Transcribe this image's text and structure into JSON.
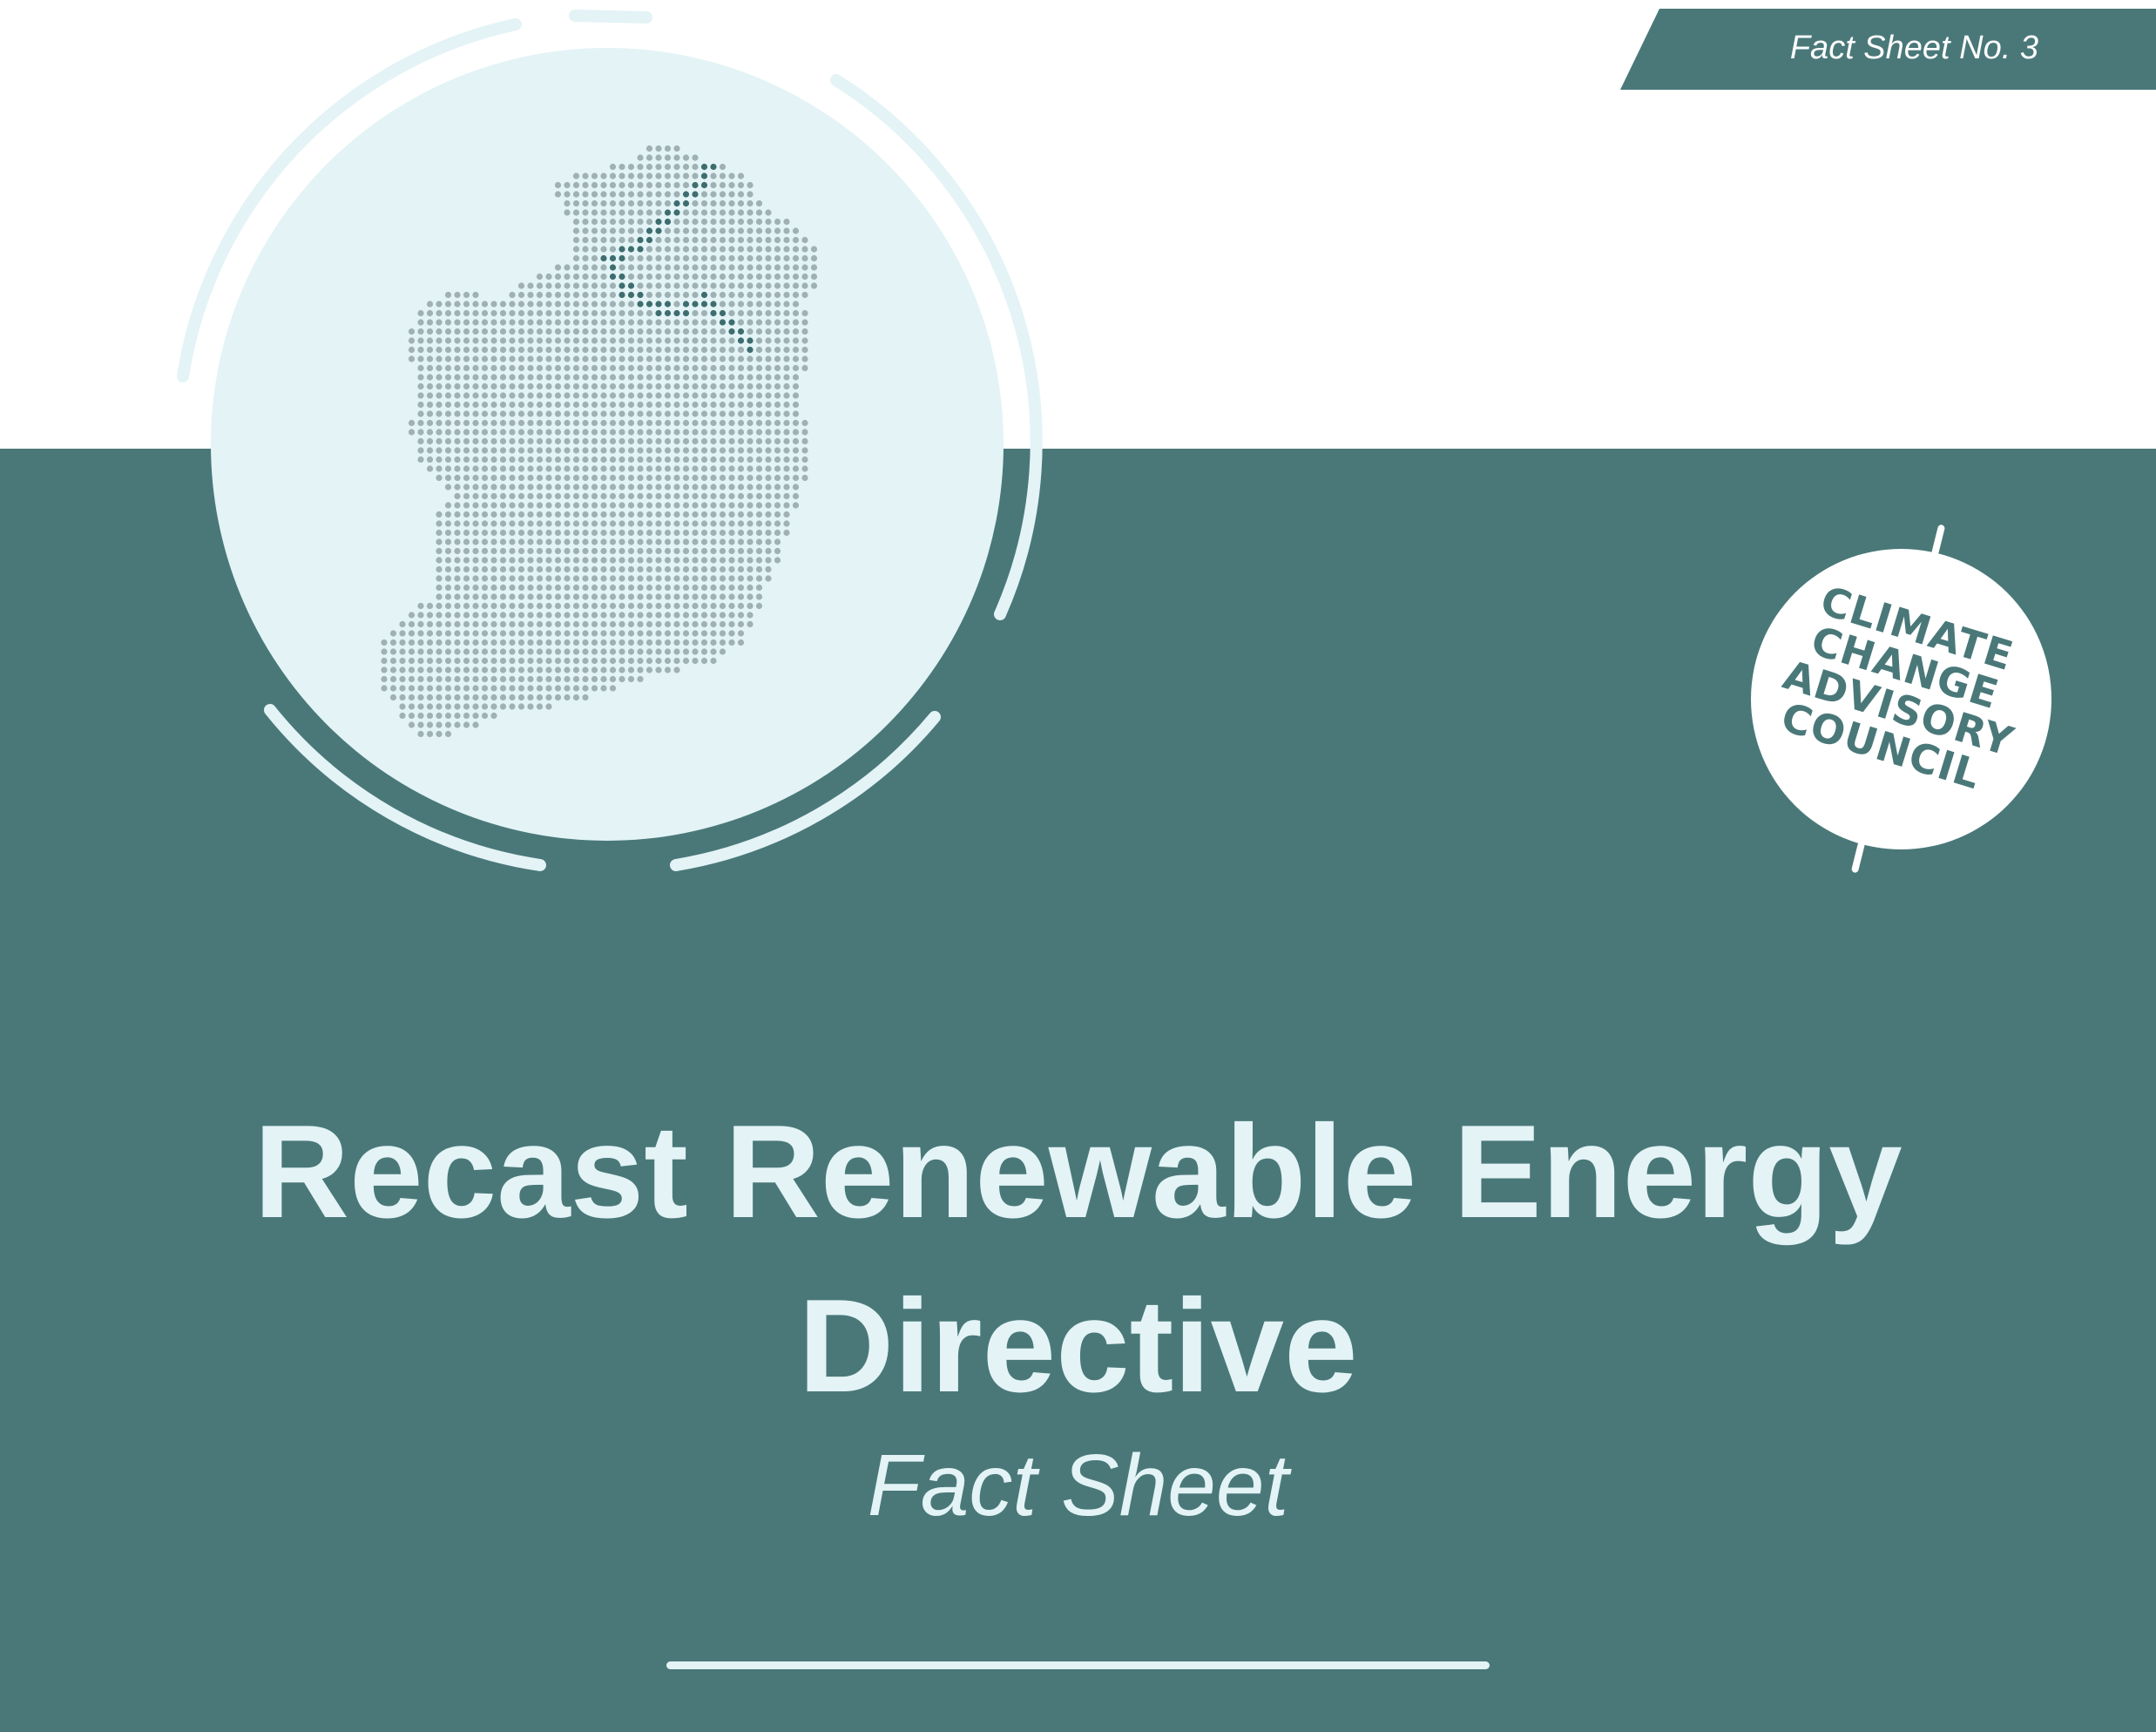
{
  "header": {
    "fact_sheet_label": "Fact Sheet No. 3"
  },
  "logo": {
    "lines": [
      "CLIMATE",
      "CHANGE",
      "ADVISORY",
      "COUNCIL"
    ]
  },
  "title": {
    "line1": "Recast Renewable Energy",
    "line2": "Directive"
  },
  "subtitle": "Fact Sheet",
  "colors": {
    "teal": "#4a7879",
    "light_cyan": "#e3f3f6",
    "dot_grey": "#9fb1b3",
    "dot_dark": "#3e6d6f",
    "white": "#ffffff"
  },
  "illustration": {
    "subject": "dotted-map-of-ireland",
    "icon": "ireland-dot-map-icon"
  }
}
